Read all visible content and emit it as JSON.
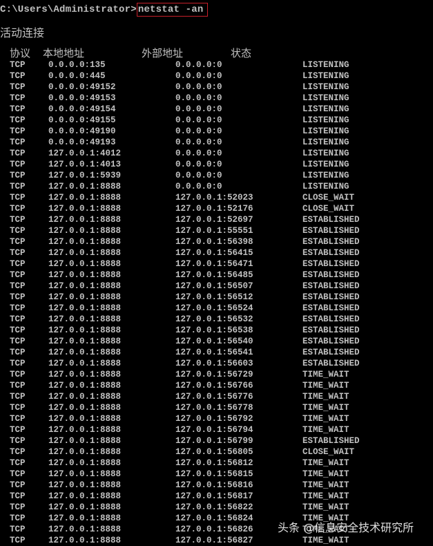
{
  "console": {
    "prompt": "C:\\Users\\Administrator>",
    "command": "netstat -an",
    "highlight_color": "#c8202a",
    "title": "活动连接",
    "headers": {
      "proto": "协议",
      "local": "本地地址",
      "foreign": "外部地址",
      "state": "状态"
    },
    "rows": [
      {
        "proto": "TCP",
        "local": "0.0.0.0:135",
        "foreign": "0.0.0.0:0",
        "state": "LISTENING"
      },
      {
        "proto": "TCP",
        "local": "0.0.0.0:445",
        "foreign": "0.0.0.0:0",
        "state": "LISTENING"
      },
      {
        "proto": "TCP",
        "local": "0.0.0.0:49152",
        "foreign": "0.0.0.0:0",
        "state": "LISTENING"
      },
      {
        "proto": "TCP",
        "local": "0.0.0.0:49153",
        "foreign": "0.0.0.0:0",
        "state": "LISTENING"
      },
      {
        "proto": "TCP",
        "local": "0.0.0.0:49154",
        "foreign": "0.0.0.0:0",
        "state": "LISTENING"
      },
      {
        "proto": "TCP",
        "local": "0.0.0.0:49155",
        "foreign": "0.0.0.0:0",
        "state": "LISTENING"
      },
      {
        "proto": "TCP",
        "local": "0.0.0.0:49190",
        "foreign": "0.0.0.0:0",
        "state": "LISTENING"
      },
      {
        "proto": "TCP",
        "local": "0.0.0.0:49193",
        "foreign": "0.0.0.0:0",
        "state": "LISTENING"
      },
      {
        "proto": "TCP",
        "local": "127.0.0.1:4012",
        "foreign": "0.0.0.0:0",
        "state": "LISTENING"
      },
      {
        "proto": "TCP",
        "local": "127.0.0.1:4013",
        "foreign": "0.0.0.0:0",
        "state": "LISTENING"
      },
      {
        "proto": "TCP",
        "local": "127.0.0.1:5939",
        "foreign": "0.0.0.0:0",
        "state": "LISTENING"
      },
      {
        "proto": "TCP",
        "local": "127.0.0.1:8888",
        "foreign": "0.0.0.0:0",
        "state": "LISTENING"
      },
      {
        "proto": "TCP",
        "local": "127.0.0.1:8888",
        "foreign": "127.0.0.1:52023",
        "state": "CLOSE_WAIT"
      },
      {
        "proto": "TCP",
        "local": "127.0.0.1:8888",
        "foreign": "127.0.0.1:52176",
        "state": "CLOSE_WAIT"
      },
      {
        "proto": "TCP",
        "local": "127.0.0.1:8888",
        "foreign": "127.0.0.1:52697",
        "state": "ESTABLISHED"
      },
      {
        "proto": "TCP",
        "local": "127.0.0.1:8888",
        "foreign": "127.0.0.1:55551",
        "state": "ESTABLISHED"
      },
      {
        "proto": "TCP",
        "local": "127.0.0.1:8888",
        "foreign": "127.0.0.1:56398",
        "state": "ESTABLISHED"
      },
      {
        "proto": "TCP",
        "local": "127.0.0.1:8888",
        "foreign": "127.0.0.1:56415",
        "state": "ESTABLISHED"
      },
      {
        "proto": "TCP",
        "local": "127.0.0.1:8888",
        "foreign": "127.0.0.1:56471",
        "state": "ESTABLISHED"
      },
      {
        "proto": "TCP",
        "local": "127.0.0.1:8888",
        "foreign": "127.0.0.1:56485",
        "state": "ESTABLISHED"
      },
      {
        "proto": "TCP",
        "local": "127.0.0.1:8888",
        "foreign": "127.0.0.1:56507",
        "state": "ESTABLISHED"
      },
      {
        "proto": "TCP",
        "local": "127.0.0.1:8888",
        "foreign": "127.0.0.1:56512",
        "state": "ESTABLISHED"
      },
      {
        "proto": "TCP",
        "local": "127.0.0.1:8888",
        "foreign": "127.0.0.1:56524",
        "state": "ESTABLISHED"
      },
      {
        "proto": "TCP",
        "local": "127.0.0.1:8888",
        "foreign": "127.0.0.1:56532",
        "state": "ESTABLISHED"
      },
      {
        "proto": "TCP",
        "local": "127.0.0.1:8888",
        "foreign": "127.0.0.1:56538",
        "state": "ESTABLISHED"
      },
      {
        "proto": "TCP",
        "local": "127.0.0.1:8888",
        "foreign": "127.0.0.1:56540",
        "state": "ESTABLISHED"
      },
      {
        "proto": "TCP",
        "local": "127.0.0.1:8888",
        "foreign": "127.0.0.1:56541",
        "state": "ESTABLISHED"
      },
      {
        "proto": "TCP",
        "local": "127.0.0.1:8888",
        "foreign": "127.0.0.1:56603",
        "state": "ESTABLISHED"
      },
      {
        "proto": "TCP",
        "local": "127.0.0.1:8888",
        "foreign": "127.0.0.1:56729",
        "state": "TIME_WAIT"
      },
      {
        "proto": "TCP",
        "local": "127.0.0.1:8888",
        "foreign": "127.0.0.1:56766",
        "state": "TIME_WAIT"
      },
      {
        "proto": "TCP",
        "local": "127.0.0.1:8888",
        "foreign": "127.0.0.1:56776",
        "state": "TIME_WAIT"
      },
      {
        "proto": "TCP",
        "local": "127.0.0.1:8888",
        "foreign": "127.0.0.1:56778",
        "state": "TIME_WAIT"
      },
      {
        "proto": "TCP",
        "local": "127.0.0.1:8888",
        "foreign": "127.0.0.1:56792",
        "state": "TIME_WAIT"
      },
      {
        "proto": "TCP",
        "local": "127.0.0.1:8888",
        "foreign": "127.0.0.1:56794",
        "state": "TIME_WAIT"
      },
      {
        "proto": "TCP",
        "local": "127.0.0.1:8888",
        "foreign": "127.0.0.1:56799",
        "state": "ESTABLISHED"
      },
      {
        "proto": "TCP",
        "local": "127.0.0.1:8888",
        "foreign": "127.0.0.1:56805",
        "state": "CLOSE_WAIT"
      },
      {
        "proto": "TCP",
        "local": "127.0.0.1:8888",
        "foreign": "127.0.0.1:56812",
        "state": "TIME_WAIT"
      },
      {
        "proto": "TCP",
        "local": "127.0.0.1:8888",
        "foreign": "127.0.0.1:56815",
        "state": "TIME_WAIT"
      },
      {
        "proto": "TCP",
        "local": "127.0.0.1:8888",
        "foreign": "127.0.0.1:56816",
        "state": "TIME_WAIT"
      },
      {
        "proto": "TCP",
        "local": "127.0.0.1:8888",
        "foreign": "127.0.0.1:56817",
        "state": "TIME_WAIT"
      },
      {
        "proto": "TCP",
        "local": "127.0.0.1:8888",
        "foreign": "127.0.0.1:56822",
        "state": "TIME_WAIT"
      },
      {
        "proto": "TCP",
        "local": "127.0.0.1:8888",
        "foreign": "127.0.0.1:56824",
        "state": "TIME_WAIT"
      },
      {
        "proto": "TCP",
        "local": "127.0.0.1:8888",
        "foreign": "127.0.0.1:56826",
        "state": "TIME_WAIT"
      },
      {
        "proto": "TCP",
        "local": "127.0.0.1:8888",
        "foreign": "127.0.0.1:56827",
        "state": "TIME_WAIT"
      }
    ]
  },
  "watermark": {
    "text": "头条 @信息安全技术研究所"
  },
  "colors": {
    "background": "#000000",
    "text": "#c0c0c0",
    "highlight_box": "#c8202a"
  }
}
